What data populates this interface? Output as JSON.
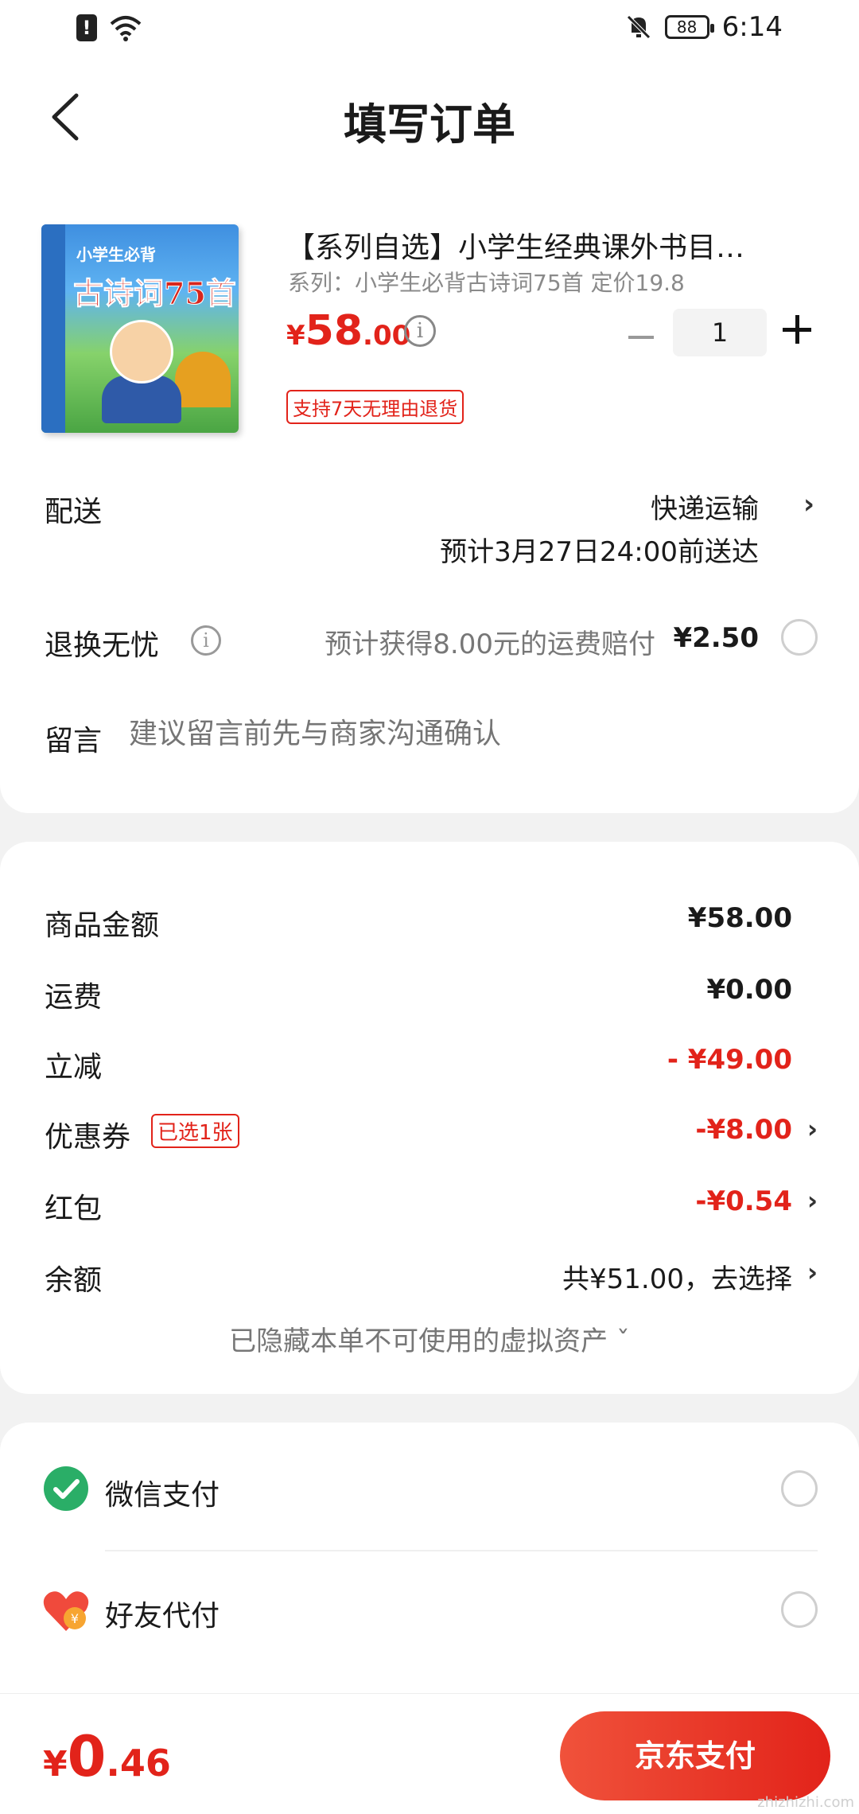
{
  "status_bar": {
    "time": "6:14",
    "battery": "88"
  },
  "header": {
    "title": "填写订单"
  },
  "product": {
    "title": "【系列自选】小学生经典课外书目…",
    "spec": "系列：小学生必背古诗词75首 定价19.8",
    "price_symbol": "¥",
    "price_int": "58",
    "price_dec": ".00",
    "quantity": "1",
    "return_badge": "支持7天无理由退货",
    "cover_small_text": "小学生必背",
    "cover_big_text": "古诗词75首"
  },
  "delivery": {
    "label": "配送",
    "method": "快递运输",
    "eta": "预计3月27日24:00前送达"
  },
  "return_service": {
    "label": "退换无忧",
    "desc": "预计获得8.00元的运费赔付",
    "price": "¥2.50"
  },
  "message": {
    "label": "留言",
    "placeholder": "建议留言前先与商家沟通确认"
  },
  "summary": {
    "goods_label": "商品金额",
    "goods_value": "¥58.00",
    "shipping_label": "运费",
    "shipping_value": "¥0.00",
    "discount_label": "立减",
    "discount_value": "- ¥49.00",
    "coupon_label": "优惠券",
    "coupon_badge": "已选1张",
    "coupon_value": "-¥8.00",
    "redpacket_label": "红包",
    "redpacket_value": "-¥0.54",
    "balance_label": "余额",
    "balance_value": "共¥51.00，去选择",
    "hidden_assets": "已隐藏本单不可使用的虚拟资产 ˇ"
  },
  "payment": {
    "wechat_label": "微信支付",
    "friend_label": "好友代付"
  },
  "bottom": {
    "total_symbol": "¥",
    "total_int": "0",
    "total_dec": ".46",
    "pay_button": "京东支付",
    "watermark": "zhizhizhi.com"
  },
  "colors": {
    "accent": "#e2231a",
    "wechat": "#2aae67"
  }
}
